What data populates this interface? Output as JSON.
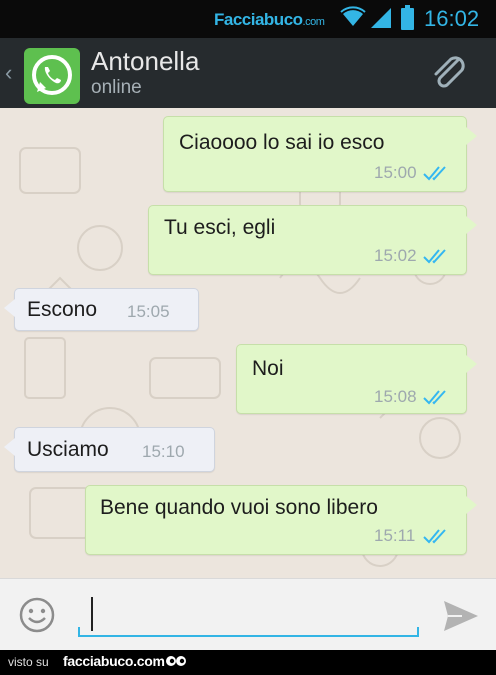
{
  "status_bar": {
    "watermark": "Facciabuco",
    "watermark_tld": ".com",
    "time": "16:02"
  },
  "action_bar": {
    "contact_name": "Antonella",
    "contact_status": "online"
  },
  "messages": [
    {
      "direction": "outgoing",
      "text": "Ciaoooo lo sai io esco",
      "time": "15:00",
      "read": true
    },
    {
      "direction": "outgoing",
      "text": "Tu esci, egli",
      "time": "15:02",
      "read": true
    },
    {
      "direction": "incoming",
      "text": "Escono",
      "time": "15:05"
    },
    {
      "direction": "outgoing",
      "text": "Noi",
      "time": "15:08",
      "read": true
    },
    {
      "direction": "incoming",
      "text": "Usciamo",
      "time": "15:10"
    },
    {
      "direction": "outgoing",
      "text": "Bene quando vuoi sono libero",
      "time": "15:11",
      "read": true
    }
  ],
  "composer": {
    "value": ""
  },
  "footer": {
    "prefix": "visto su",
    "brand": "facciabuco.com"
  },
  "colors": {
    "accent": "#33b5e5",
    "read_ticks": "#34b7f1",
    "outgoing_bubble": "#e1f7c9",
    "incoming_bubble": "#eef0f6",
    "action_bar": "#262b2e",
    "chat_background": "#ece5dd"
  },
  "icons": {
    "back": "chevron-left-icon",
    "avatar": "whatsapp-logo-icon",
    "attach": "paperclip-icon",
    "emoji": "smiley-icon",
    "send": "send-arrow-icon",
    "wifi": "wifi-icon",
    "signal": "signal-icon",
    "battery": "battery-icon",
    "read": "double-check-icon"
  }
}
